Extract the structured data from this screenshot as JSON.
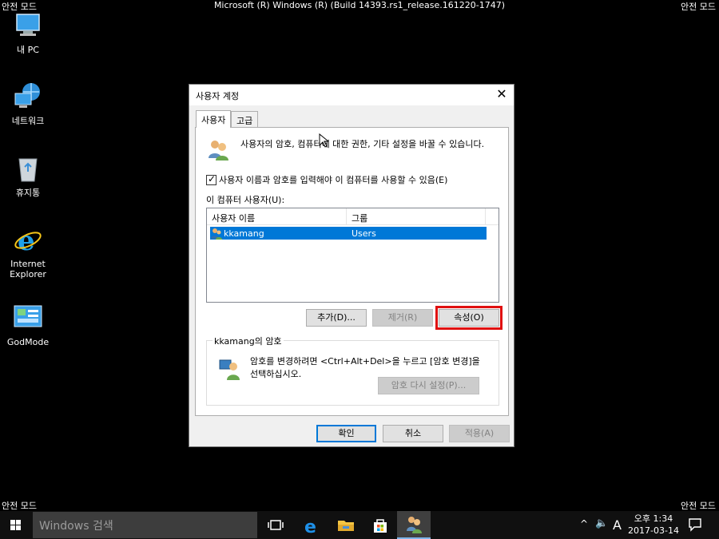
{
  "desktop": {
    "safe_mode": "안전 모드",
    "build_info": "Microsoft (R) Windows (R) (Build 14393.rs1_release.161220-1747)",
    "icons": [
      {
        "label": "내 PC",
        "icon": "computer-icon"
      },
      {
        "label": "네트워크",
        "icon": "network-icon"
      },
      {
        "label": "휴지통",
        "icon": "recycle-bin-icon"
      },
      {
        "label": "Internet Explorer",
        "icon": "ie-icon"
      },
      {
        "label": "GodMode",
        "icon": "control-panel-icon"
      }
    ]
  },
  "dialog": {
    "title": "사용자 계정",
    "close": "✕",
    "tabs": [
      "사용자",
      "고급"
    ],
    "intro": "사용자의 암호, 컴퓨터에 대한 권한, 기타 설정을 바꿀 수 있습니다.",
    "checkbox_label": "사용자 이름과 암호를 입력해야 이 컴퓨터를 사용할 수 있음(E)",
    "checkbox_checked": true,
    "users_label": "이 컴퓨터 사용자(U):",
    "columns": [
      "사용자 이름",
      "그룹"
    ],
    "rows": [
      {
        "name": "kkamang",
        "group": "Users",
        "selected": true
      }
    ],
    "buttons": {
      "add": "추가(D)...",
      "remove": "제거(R)",
      "properties": "속성(O)"
    },
    "password_group": {
      "title": "kkamang의 암호",
      "text": "암호를 변경하려면 <Ctrl+Alt+Del>을 누르고 [암호 변경]을 선택하십시오.",
      "reset": "암호 다시 설정(P)..."
    },
    "footer": {
      "ok": "확인",
      "cancel": "취소",
      "apply": "적용(A)"
    }
  },
  "taskbar": {
    "search_placeholder": "Windows 검색",
    "tray": {
      "chevron": "^",
      "volume": "🔈",
      "ime": "A"
    },
    "clock_time": "오후 1:34",
    "clock_date": "2017-03-14"
  },
  "colors": {
    "selection": "#0078d7",
    "highlight_outline": "#e01010",
    "taskbar": "#101010"
  }
}
